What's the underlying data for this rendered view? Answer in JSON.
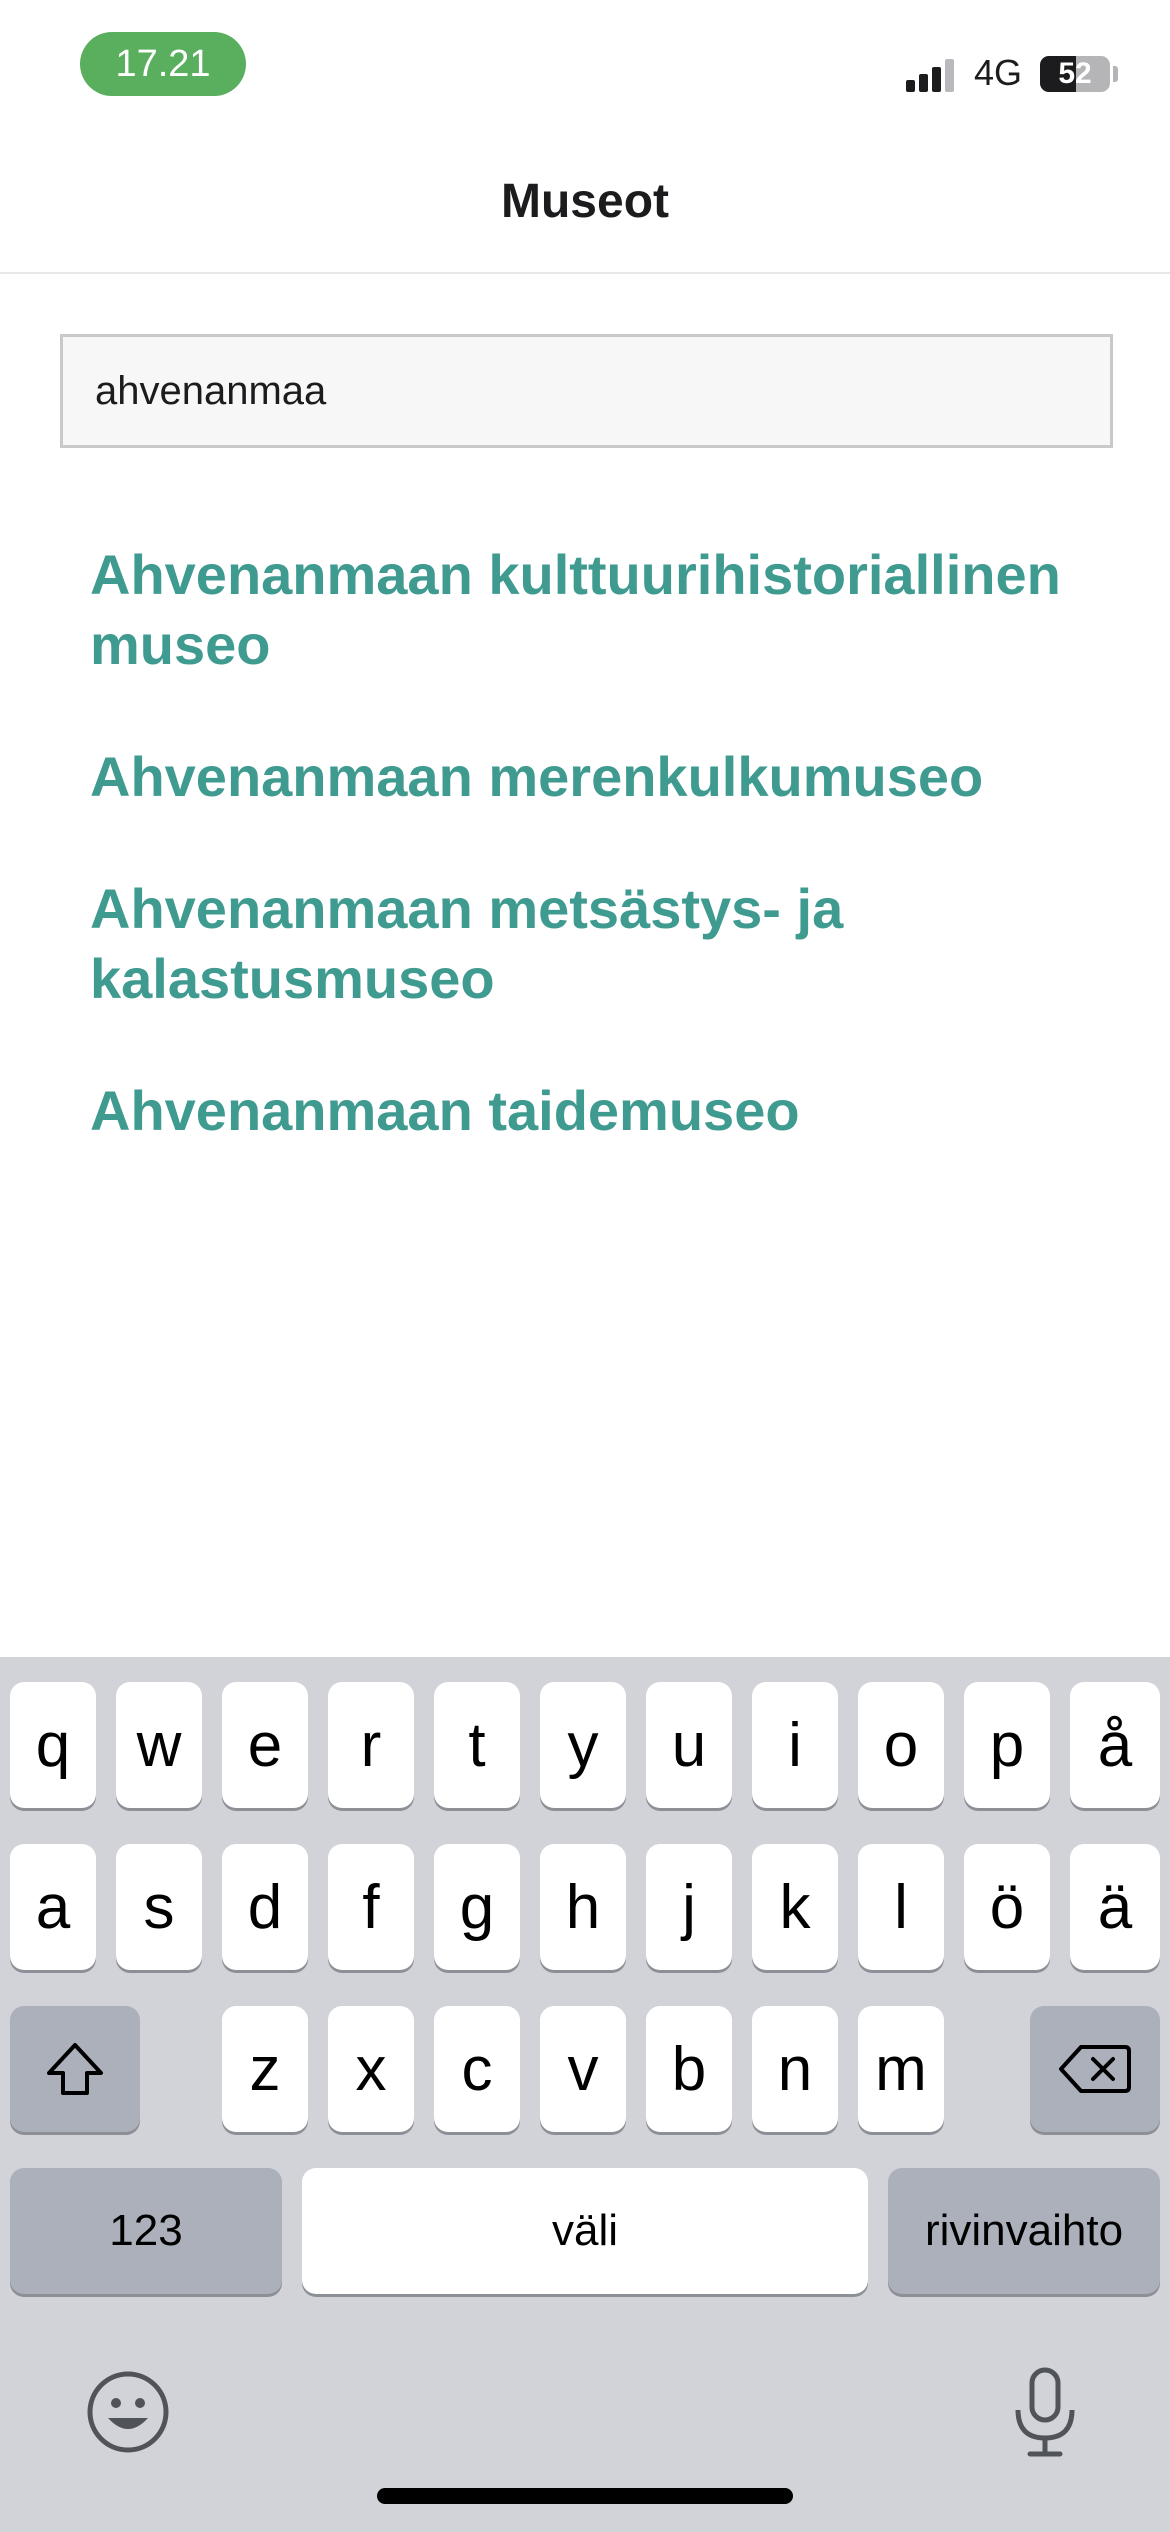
{
  "status_bar": {
    "time": "17.21",
    "network": "4G",
    "battery": "52",
    "battery_level": 0.52
  },
  "nav": {
    "title": "Museot"
  },
  "search": {
    "value": "ahvenanmaa"
  },
  "results": [
    "Ahvenanmaan kulttuurihistoriallinen museo",
    "Ahvenanmaan merenkulkumuseo",
    "Ahvenanmaan metsästys- ja kalastusmuseo",
    "Ahvenanmaan taidemuseo"
  ],
  "keyboard": {
    "row1": [
      "q",
      "w",
      "e",
      "r",
      "t",
      "y",
      "u",
      "i",
      "o",
      "p",
      "å"
    ],
    "row2": [
      "a",
      "s",
      "d",
      "f",
      "g",
      "h",
      "j",
      "k",
      "l",
      "ö",
      "ä"
    ],
    "row3": [
      "z",
      "x",
      "c",
      "v",
      "b",
      "n",
      "m"
    ],
    "numbers_label": "123",
    "space_label": "väli",
    "return_label": "rivinvaihto",
    "icons": [
      "shift-icon",
      "backspace-icon",
      "emoji-icon",
      "microphone-icon"
    ]
  },
  "colors": {
    "accent": "#3f9a90",
    "time_pill": "#5aaf5e",
    "keyboard_bg": "#d1d3d9"
  }
}
